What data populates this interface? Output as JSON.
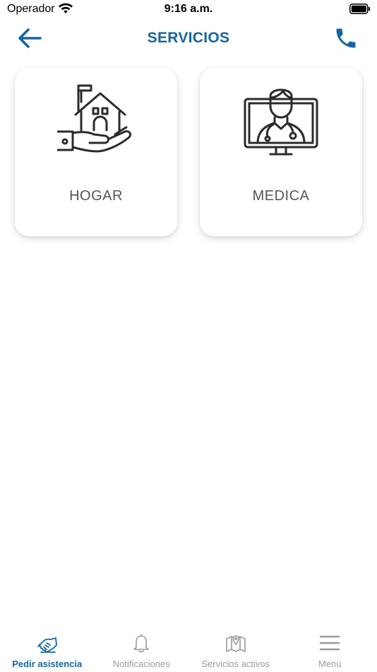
{
  "status_bar": {
    "carrier": "Operador",
    "time": "9:16 a.m."
  },
  "nav": {
    "title": "SERVICIOS",
    "back_icon": "arrow-left-icon",
    "phone_icon": "phone-icon"
  },
  "colors": {
    "accent": "#1565a0",
    "icon_dark": "#2b2b2b",
    "inactive": "#9a9a9a",
    "card_label": "#555555"
  },
  "services": [
    {
      "label": "HOGAR",
      "icon": "house-in-hand-icon"
    },
    {
      "label": "MEDICA",
      "icon": "doctor-monitor-icon"
    }
  ],
  "tabs": [
    {
      "label": "Pedir asistencia",
      "icon": "handshake-icon",
      "active": true
    },
    {
      "label": "Notificaciones",
      "icon": "bell-icon",
      "active": false
    },
    {
      "label": "Servicios activos",
      "icon": "map-pin-icon",
      "active": false
    },
    {
      "label": "Menú",
      "icon": "hamburger-menu-icon",
      "active": false
    }
  ]
}
